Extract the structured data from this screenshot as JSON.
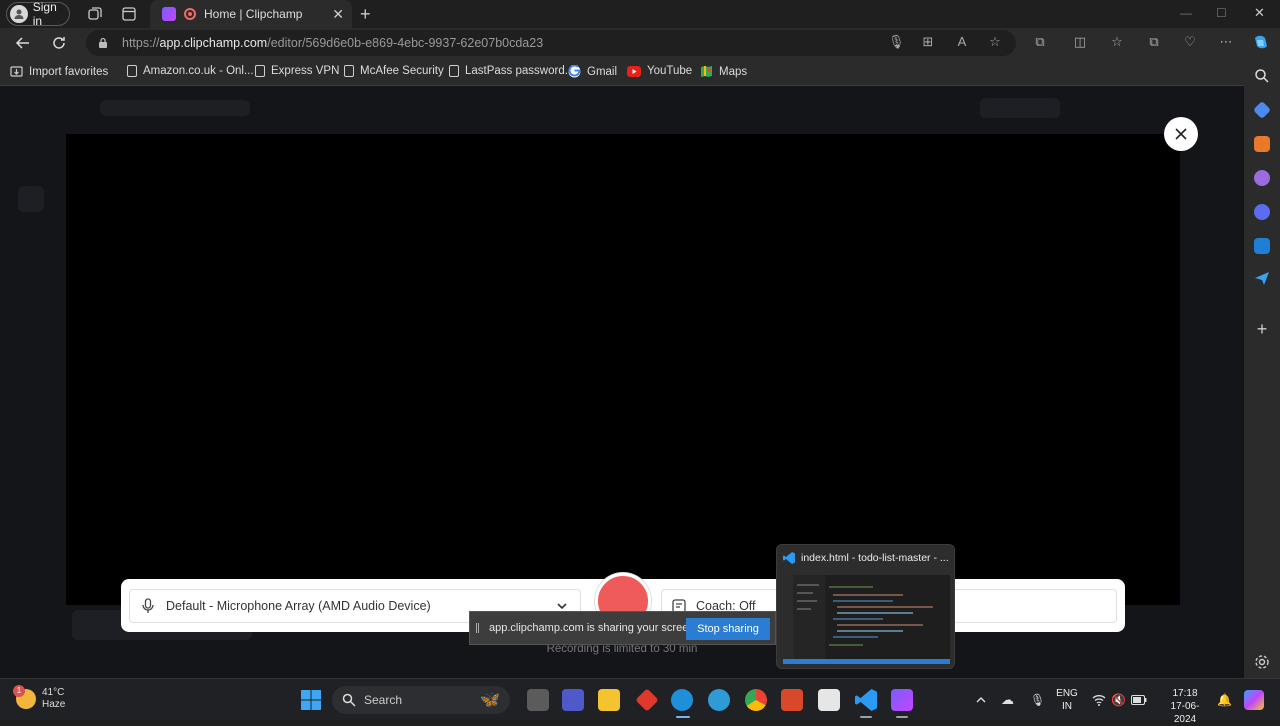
{
  "browser": {
    "signin_label": "Sign in",
    "tab_title": "Home | Clipchamp",
    "url_prefix": "https://",
    "url_host": "app.clipchamp.com",
    "url_path": "/editor/569d6e0b-e869-4ebc-9937-62e07b0cda23"
  },
  "bookmarks": [
    {
      "label": "Import favorites",
      "icon": "import-icon"
    },
    {
      "label": "Amazon.co.uk - Onl...",
      "icon": "page-icon"
    },
    {
      "label": "Express VPN",
      "icon": "page-icon"
    },
    {
      "label": "McAfee Security",
      "icon": "page-icon"
    },
    {
      "label": "LastPass password...",
      "icon": "page-icon"
    },
    {
      "label": "Gmail",
      "icon": "google-icon"
    },
    {
      "label": "YouTube",
      "icon": "youtube-icon"
    },
    {
      "label": "Maps",
      "icon": "maps-icon"
    }
  ],
  "recorder": {
    "microphone": "Default - Microphone Array (AMD Audio Device)",
    "coach": "Coach: Off",
    "limit_text": "Recording is limited to 30 min"
  },
  "share_bar": {
    "message": "app.clipchamp.com is sharing your screen.",
    "stop_label": "Stop sharing"
  },
  "thumbnail": {
    "title": "index.html - todo-list-master - ..."
  },
  "taskbar": {
    "temperature": "41°C",
    "condition": "Haze",
    "weather_badge": "1",
    "search_placeholder": "Search",
    "lang_line1": "ENG",
    "lang_line2": "IN",
    "time": "17:18",
    "date": "17-06-2024"
  },
  "colors": {
    "record_red": "#ef5b5b",
    "stop_blue": "#2b7cd3",
    "page_bg": "#141518"
  }
}
